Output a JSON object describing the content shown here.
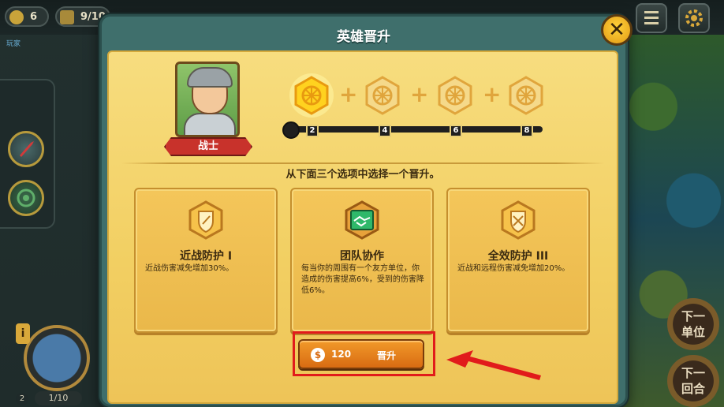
{
  "top_bar": {
    "gold_count": "6",
    "food_count": "9/10",
    "sub_label": "玩家"
  },
  "modal": {
    "title": "英雄晋升",
    "close_icon": "close-x-icon"
  },
  "hero": {
    "class_name": "战士",
    "rank_markers": [
      "2",
      "4",
      "6",
      "8"
    ],
    "current_rank_index": 0
  },
  "instruction": "从下面三个选项中选择一个晋升。",
  "options": [
    {
      "icon": "melee-shield-icon",
      "title": "近战防护 I",
      "description": "近战伤害减免增加30%。"
    },
    {
      "icon": "handshake-icon",
      "title": "团队协作",
      "description": "每当你的周围有一个友方单位，你造成的伤害提高6%，受到的伤害降低6%。"
    },
    {
      "icon": "full-shield-icon",
      "title": "全效防护 III",
      "description": "近战和远程伤害减免增加20%。"
    }
  ],
  "promote": {
    "cost": "120",
    "label": "晋升"
  },
  "side_buttons": {
    "next_unit": "下一\n单位",
    "next_turn": "下一\n回合"
  },
  "bottom": {
    "unit_count": "1/10",
    "level": "2"
  },
  "colors": {
    "accent_orange": "#d86b12",
    "highlight_red": "#e11b1b",
    "parchment": "#f2cf62"
  }
}
